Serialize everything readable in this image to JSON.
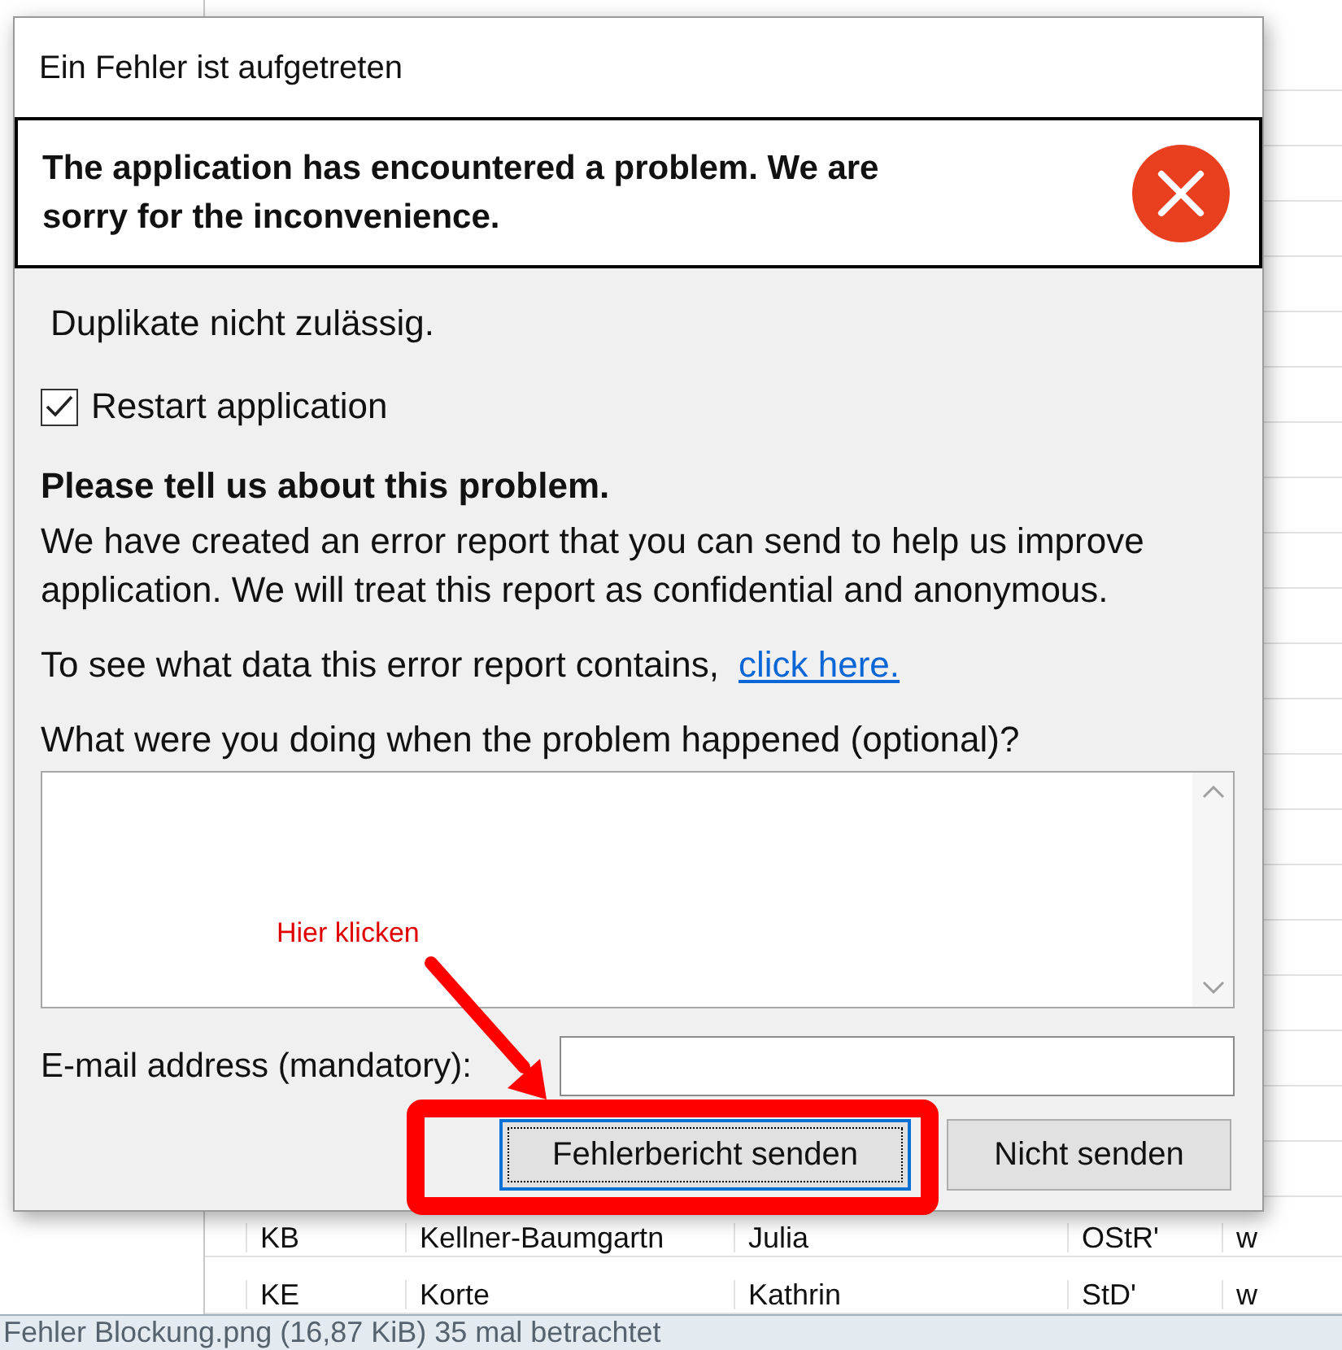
{
  "background_table": {
    "bottom_rows": [
      {
        "cells": [
          "KB",
          "Kellner-Baumgartn",
          "Julia",
          "OStR'",
          "w"
        ]
      },
      {
        "cells": [
          "KE",
          "Korte",
          "Kathrin",
          "StD'",
          "w"
        ]
      }
    ]
  },
  "dialog": {
    "title": "Ein Fehler ist aufgetreten",
    "header_message": "The application has encountered a problem. We are sorry for the inconvenience.",
    "error_message": "Duplikate nicht zulässig.",
    "restart_checkbox": {
      "label": "Restart application",
      "checked": true
    },
    "prompt_heading": "Please tell us about this problem.",
    "prompt_text": "We have created an error report that you can send to help us improve application. We will treat this report as confidential and anonymous.",
    "details_text": "To see what data this error report contains,",
    "details_link": "click here.",
    "description_label": "What were you doing when the problem happened (optional)?",
    "email_label": "E-mail address (mandatory):",
    "buttons": [
      {
        "label": "Fehlerbericht senden",
        "focused": true
      },
      {
        "label": "Nicht senden",
        "focused": false
      }
    ]
  },
  "annotation": {
    "text": "Hier klicken"
  },
  "image_caption": "Fehler Blockung.png (16,87 KiB) 35 mal betrachtet"
}
